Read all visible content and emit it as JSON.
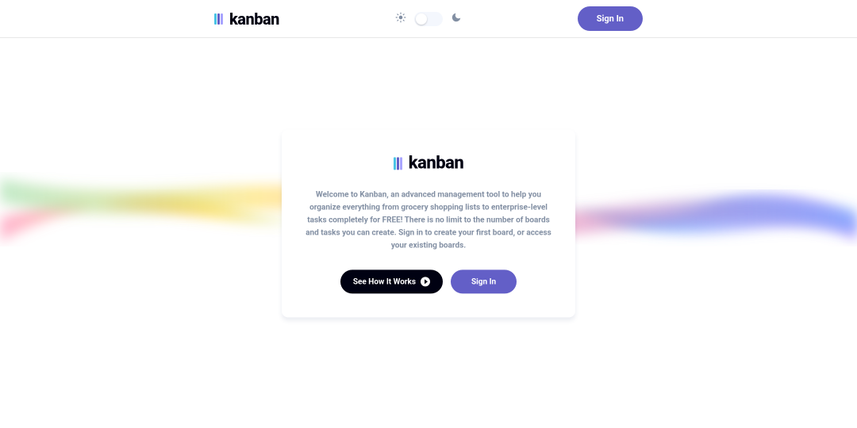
{
  "header": {
    "logo_text": "kanban",
    "signin_label": "Sign In"
  },
  "card": {
    "logo_text": "kanban",
    "description": "Welcome to Kanban, an advanced management tool to help you organize everything from grocery shopping lists to enterprise-level tasks completely for FREE! There is no limit to the number of boards and tasks you can create. Sign in to create your first board, or access your existing boards.",
    "see_how_label": "See How It Works",
    "signin_label": "Sign In"
  }
}
